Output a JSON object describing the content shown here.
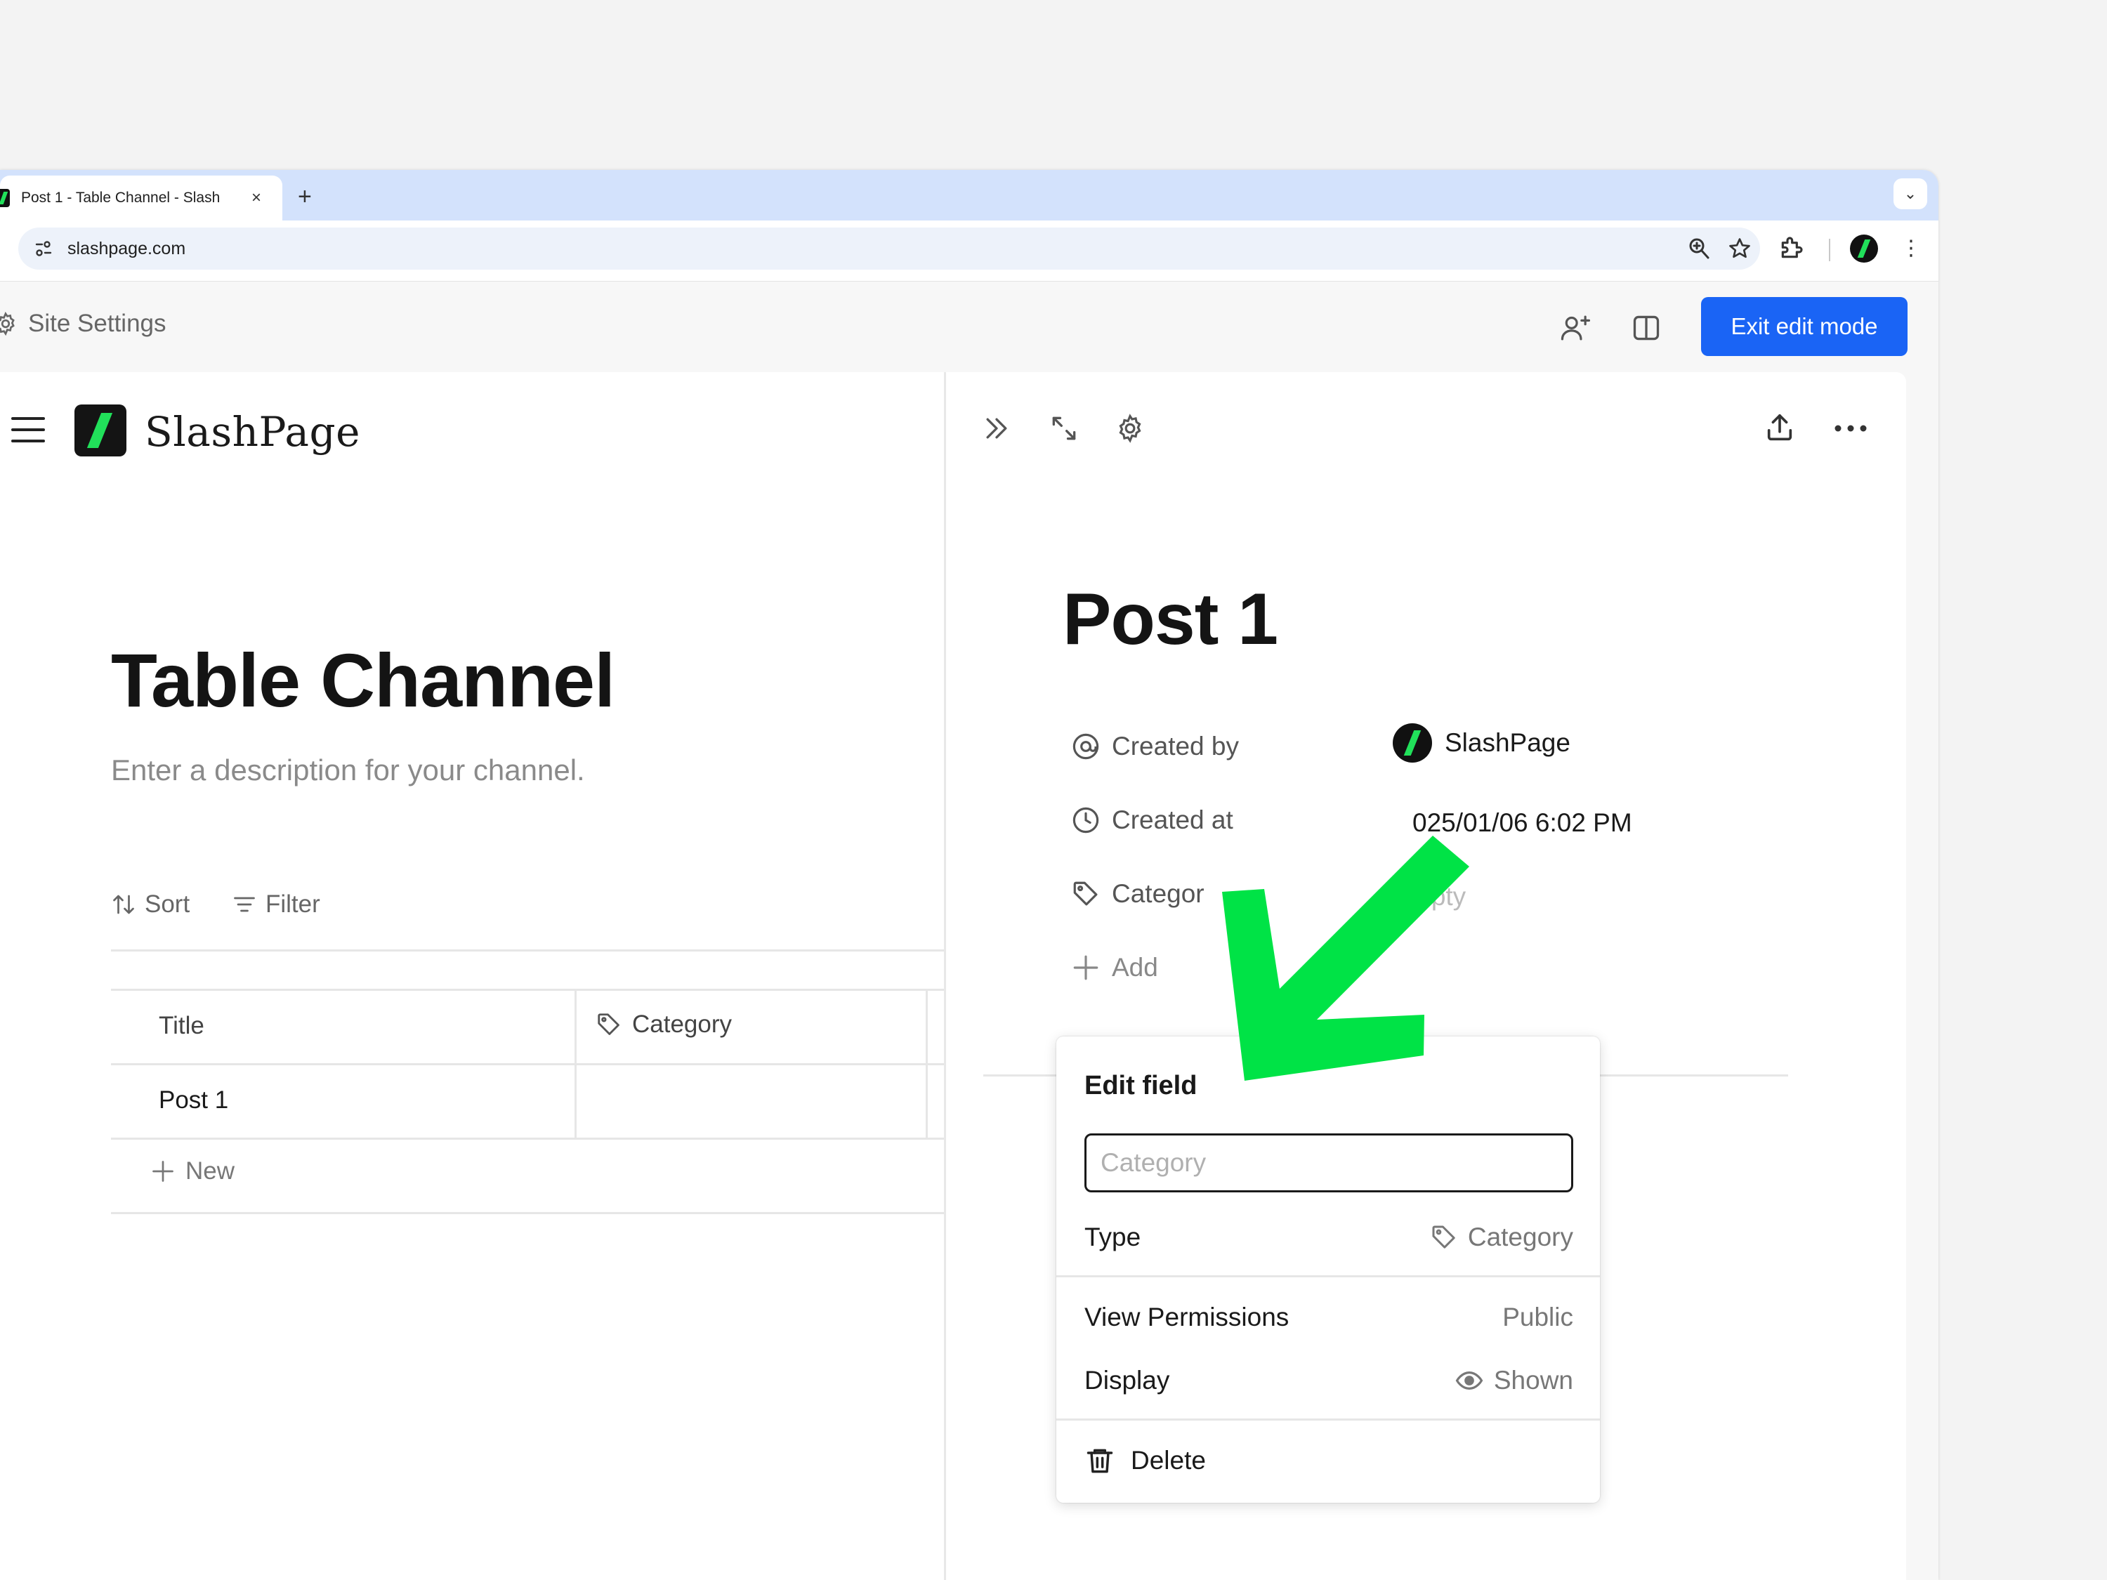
{
  "browser": {
    "tab_title": "Post 1 - Table Channel - Slash",
    "tab_close": "×",
    "new_tab": "+",
    "tab_menu": "⌄",
    "url": "slashpage.com",
    "kebab": "⋮"
  },
  "appbar": {
    "site_settings_label": "Site Settings",
    "exit_button_label": "Exit edit mode"
  },
  "left": {
    "logo_text": "SlashPage",
    "channel_title": "Table Channel",
    "channel_description": "Enter a description for your channel.",
    "sort_label": "Sort",
    "filter_label": "Filter",
    "table": {
      "columns": [
        "Title",
        "Category"
      ],
      "rows": [
        {
          "title": "Post 1",
          "category": ""
        }
      ],
      "new_label": "New"
    }
  },
  "panel": {
    "post_title": "Post 1",
    "properties": {
      "created_by_label": "Created by",
      "created_by_value": "SlashPage",
      "created_at_label": "Created at",
      "created_at_value": "025/01/06 6:02 PM",
      "category_label": "Categor",
      "category_value": "mpty",
      "add_label": "Add"
    }
  },
  "popover": {
    "heading": "Edit field",
    "input_placeholder": "Category",
    "type_label": "Type",
    "type_value": "Category",
    "view_permissions_label": "View Permissions",
    "view_permissions_value": "Public",
    "display_label": "Display",
    "display_value": "Shown",
    "delete_label": "Delete"
  },
  "colors": {
    "accent": "#1a64f5",
    "brand_green": "#21e05a",
    "annotation_green": "#00e346",
    "tabstrip": "#d3e2fc"
  }
}
